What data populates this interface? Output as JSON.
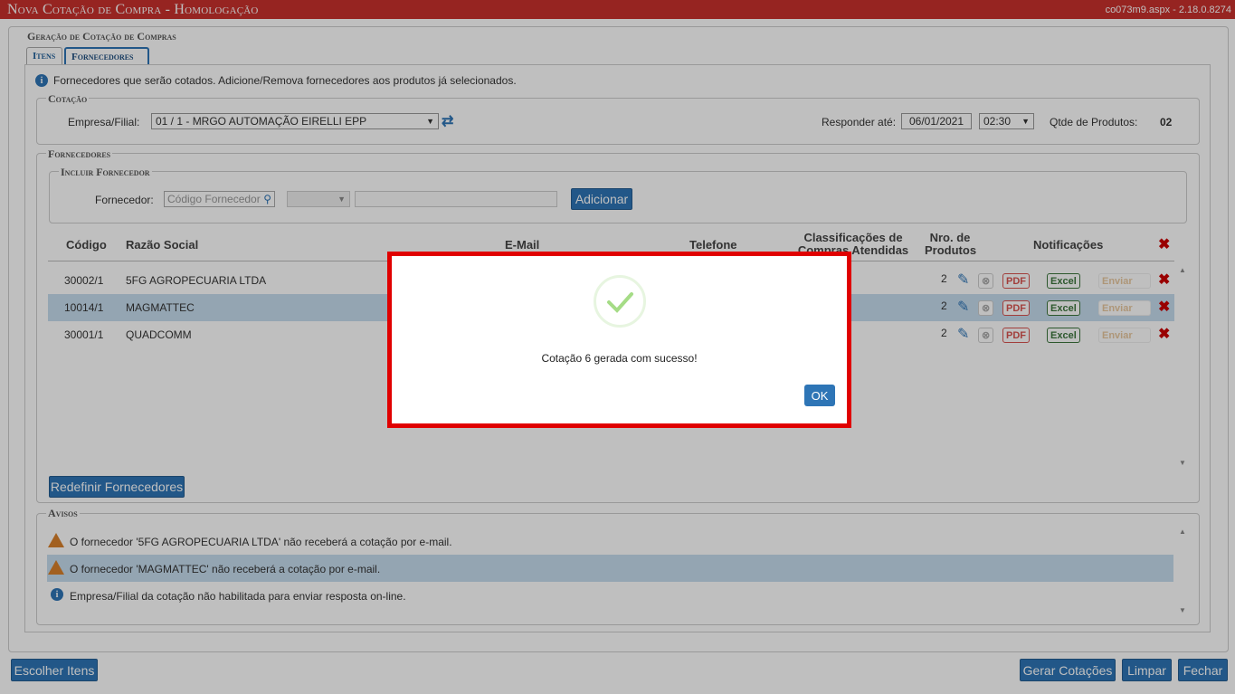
{
  "titlebar": {
    "title": "Nova Cotação de Compra  - Homologação",
    "version": "co073m9.aspx - 2.18.0.8274"
  },
  "main": {
    "legend": "Geração de Cotação de Compras",
    "tabs": [
      {
        "label": "Itens"
      },
      {
        "label": "Fornecedores"
      }
    ]
  },
  "info": {
    "text": "Fornecedores que serão cotados. Adicione/Remova fornecedores aos produtos já selecionados."
  },
  "cotacao": {
    "legend": "Cotação",
    "empresa_label": "Empresa/Filial:",
    "empresa_value": "01 / 1 - MRGO AUTOMAÇÃO EIRELLI EPP",
    "responder_label": "Responder até:",
    "date": "06/01/2021",
    "time": "02:30",
    "qtde_label": "Qtde de Produtos:",
    "qtde_value": "02"
  },
  "fornecedores": {
    "legend": "Fornecedores",
    "incluir_legend": "Incluir Fornecedor",
    "fornecedor_label": "Fornecedor:",
    "codigo_placeholder": "Código Fornecedor",
    "adicionar": "Adicionar",
    "redefinir": "Redefinir Fornecedores"
  },
  "table": {
    "headers": {
      "codigo": "Código",
      "razao": "Razão Social",
      "email": "E-Mail",
      "telefone": "Telefone",
      "classif": "Classificações de Compras Atendidas",
      "nro": "Nro. de Produtos",
      "notif": "Notificações"
    },
    "rows": [
      {
        "codigo": "30002/1",
        "razao": "5FG AGROPECUARIA LTDA",
        "nro": "2"
      },
      {
        "codigo": "10014/1",
        "razao": "MAGMATTEC",
        "nro": "2"
      },
      {
        "codigo": "30001/1",
        "razao": "QUADCOMM",
        "nro": "2"
      }
    ],
    "pdf_label": "PDF",
    "excel_label": "Excel",
    "enviar_label": "Enviar"
  },
  "avisos": {
    "legend": "Avisos",
    "items": [
      {
        "type": "warning",
        "text": "O fornecedor '5FG AGROPECUARIA LTDA' não receberá a cotação por e-mail."
      },
      {
        "type": "warning",
        "text": "O fornecedor 'MAGMATTEC' não receberá a cotação por e-mail."
      },
      {
        "type": "info",
        "text": "Empresa/Filial da cotação não habilitada para enviar resposta on-line."
      }
    ]
  },
  "footer": {
    "escolher": "Escolher Itens",
    "gerar": "Gerar Cotações",
    "limpar": "Limpar",
    "fechar": "Fechar"
  },
  "modal": {
    "message": "Cotação 6 gerada com sucesso!",
    "ok": "OK"
  },
  "colors": {
    "titlebar": "#c9302c",
    "accent": "#2e75b6",
    "selected_row": "#c6dcee",
    "modal_border": "#e00000"
  }
}
